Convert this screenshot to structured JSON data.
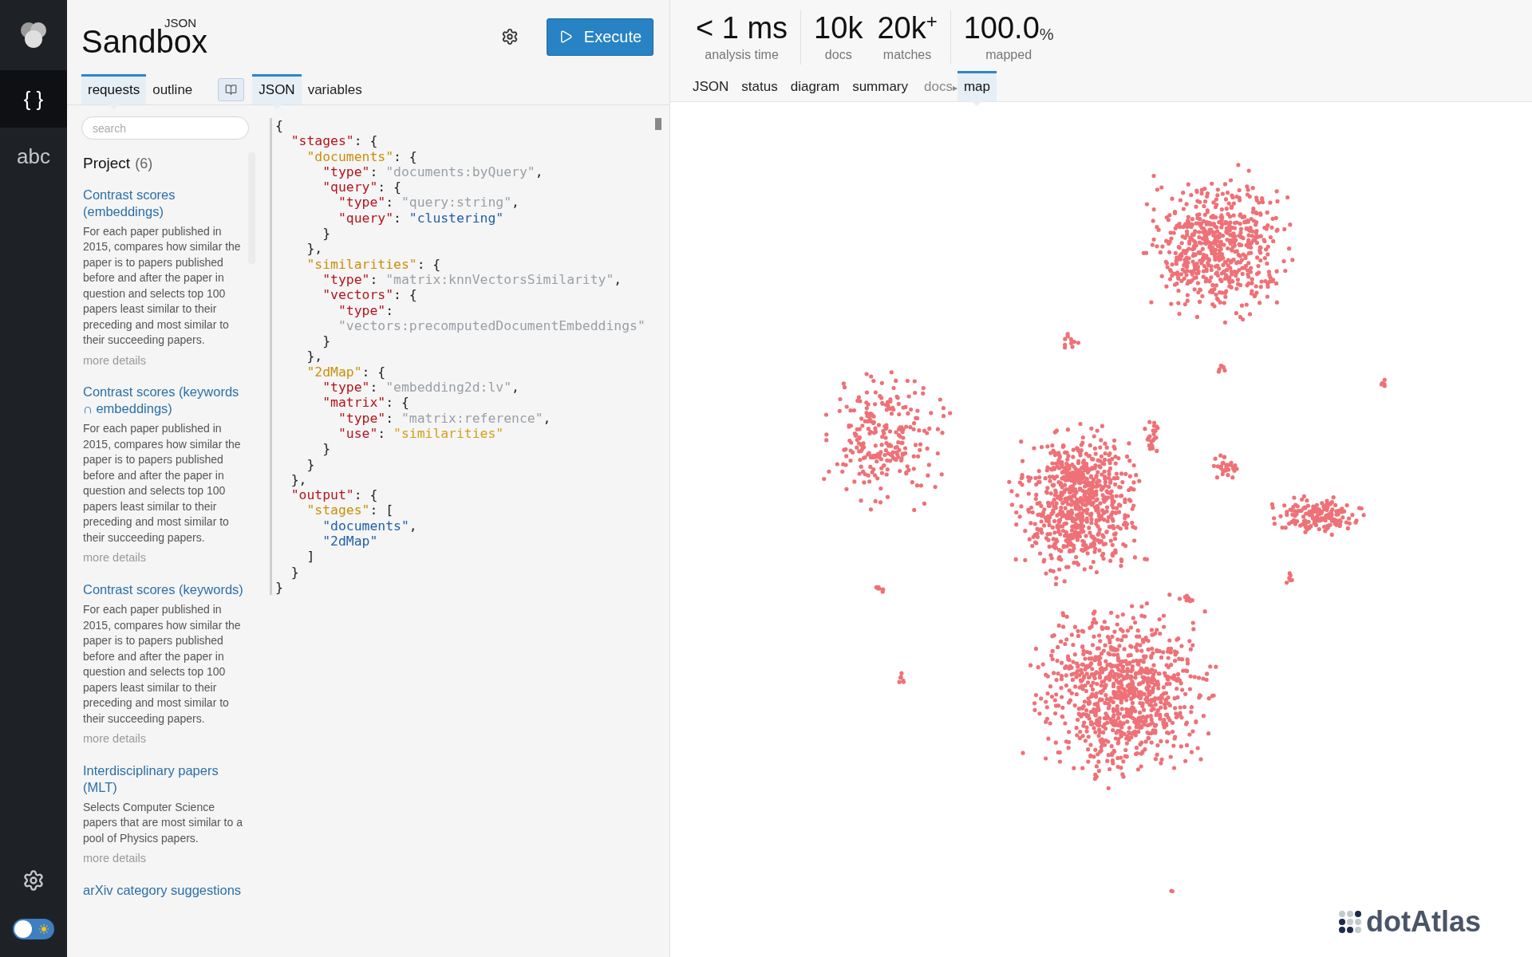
{
  "nav": {
    "items": [
      {
        "label": "{ }",
        "selected": true
      },
      {
        "label": "abc",
        "selected": false
      }
    ],
    "theme_toggle": {
      "on": false
    }
  },
  "app": {
    "title": "Sandbox",
    "super": "JSON"
  },
  "execute_button": {
    "label": "Execute"
  },
  "left_tabs": [
    {
      "label": "requests",
      "selected": true
    },
    {
      "label": "outline",
      "selected": false
    }
  ],
  "editor_tabs": [
    {
      "label": "JSON",
      "selected": true
    },
    {
      "label": "variables",
      "selected": false
    }
  ],
  "search": {
    "placeholder": "search"
  },
  "project": {
    "title": "Project",
    "count": "(6)",
    "items": [
      {
        "title": "Contrast scores (embeddings)",
        "description": "For each paper published in 2015, compares how similar the paper is to papers published before and after the paper in question and selects top 100 papers least similar to their preceding and most similar to their succeeding papers.",
        "link": "more details"
      },
      {
        "title": "Contrast scores (keywords ∩ embeddings)",
        "description": "For each paper published in 2015, compares how similar the paper is to papers published before and after the paper in question and selects top 100 papers least similar to their preceding and most similar to their succeeding papers.",
        "link": "more details"
      },
      {
        "title": "Contrast scores (keywords)",
        "description": "For each paper published in 2015, compares how similar the paper is to papers published before and after the paper in question and selects top 100 papers least similar to their preceding and most similar to their succeeding papers.",
        "link": "more details"
      },
      {
        "title": "Interdisciplinary papers (MLT)",
        "description": "Selects Computer Science papers that are most similar to a pool of Physics papers.",
        "link": "more details"
      },
      {
        "title": "arXiv category suggestions"
      }
    ]
  },
  "code": {
    "lines": [
      [
        {
          "kind": "p",
          "text": "{"
        }
      ],
      [
        {
          "kind": "key",
          "text": "  \"stages\""
        },
        {
          "kind": "p",
          "text": ": {"
        }
      ],
      [
        {
          "kind": "stage",
          "text": "    \"documents\""
        },
        {
          "kind": "p",
          "text": ": {"
        }
      ],
      [
        {
          "kind": "key",
          "text": "      \"type\""
        },
        {
          "kind": "p",
          "text": ": "
        },
        {
          "kind": "str",
          "text": "\"documents:byQuery\""
        },
        {
          "kind": "p",
          "text": ","
        }
      ],
      [
        {
          "kind": "key",
          "text": "      \"query\""
        },
        {
          "kind": "p",
          "text": ": {"
        }
      ],
      [
        {
          "kind": "key",
          "text": "        \"type\""
        },
        {
          "kind": "p",
          "text": ": "
        },
        {
          "kind": "str",
          "text": "\"query:string\""
        },
        {
          "kind": "p",
          "text": ","
        }
      ],
      [
        {
          "kind": "key",
          "text": "        \"query\""
        },
        {
          "kind": "p",
          "text": ": "
        },
        {
          "kind": "val",
          "text": "\"clustering\""
        }
      ],
      [
        {
          "kind": "p",
          "text": "      }"
        }
      ],
      [
        {
          "kind": "p",
          "text": "    },"
        }
      ],
      [
        {
          "kind": "stage",
          "text": "    \"similarities\""
        },
        {
          "kind": "p",
          "text": ": {"
        }
      ],
      [
        {
          "kind": "key",
          "text": "      \"type\""
        },
        {
          "kind": "p",
          "text": ": "
        },
        {
          "kind": "str",
          "text": "\"matrix:knnVectorsSimilarity\""
        },
        {
          "kind": "p",
          "text": ","
        }
      ],
      [
        {
          "kind": "key",
          "text": "      \"vectors\""
        },
        {
          "kind": "p",
          "text": ": {"
        }
      ],
      [
        {
          "kind": "key",
          "text": "        \"type\""
        },
        {
          "kind": "p",
          "text": ":"
        }
      ],
      [
        {
          "kind": "str",
          "text": "        \"vectors:precomputedDocumentEmbeddings\""
        }
      ],
      [
        {
          "kind": "p",
          "text": "      }"
        }
      ],
      [
        {
          "kind": "p",
          "text": "    },"
        }
      ],
      [
        {
          "kind": "stage",
          "text": "    \"2dMap\""
        },
        {
          "kind": "p",
          "text": ": {"
        }
      ],
      [
        {
          "kind": "key",
          "text": "      \"type\""
        },
        {
          "kind": "p",
          "text": ": "
        },
        {
          "kind": "str",
          "text": "\"embedding2d:lv\""
        },
        {
          "kind": "p",
          "text": ","
        }
      ],
      [
        {
          "kind": "key",
          "text": "      \"matrix\""
        },
        {
          "kind": "p",
          "text": ": {"
        }
      ],
      [
        {
          "kind": "key",
          "text": "        \"type\""
        },
        {
          "kind": "p",
          "text": ": "
        },
        {
          "kind": "str",
          "text": "\"matrix:reference\""
        },
        {
          "kind": "p",
          "text": ","
        }
      ],
      [
        {
          "kind": "key",
          "text": "        \"use\""
        },
        {
          "kind": "p",
          "text": ": "
        },
        {
          "kind": "ref",
          "text": "\"similarities\""
        }
      ],
      [
        {
          "kind": "p",
          "text": "      }"
        }
      ],
      [
        {
          "kind": "p",
          "text": "    }"
        }
      ],
      [
        {
          "kind": "p",
          "text": "  },"
        }
      ],
      [
        {
          "kind": "key",
          "text": "  \"output\""
        },
        {
          "kind": "p",
          "text": ": {"
        }
      ],
      [
        {
          "kind": "stage",
          "text": "    \"stages\""
        },
        {
          "kind": "p",
          "text": ": ["
        }
      ],
      [
        {
          "kind": "val",
          "text": "      \"documents\""
        },
        {
          "kind": "p",
          "text": ","
        }
      ],
      [
        {
          "kind": "val",
          "text": "      \"2dMap\""
        }
      ],
      [
        {
          "kind": "p",
          "text": "    ]"
        }
      ],
      [
        {
          "kind": "p",
          "text": "  }"
        }
      ],
      [
        {
          "kind": "p",
          "text": "}"
        }
      ]
    ]
  },
  "stats": [
    [
      {
        "value": "< 1 ms",
        "label": "analysis time"
      }
    ],
    [
      {
        "value": "10k",
        "label": "docs"
      },
      {
        "value": "20k",
        "unit": "+",
        "kind": "sup",
        "label": "matches"
      }
    ],
    [
      {
        "value": "100.0",
        "unit": "%",
        "kind": "sub",
        "label": "mapped"
      }
    ]
  ],
  "view_tabs": [
    {
      "label": "JSON",
      "selected": false
    },
    {
      "label": "status",
      "selected": false
    },
    {
      "label": "diagram",
      "selected": false
    },
    {
      "label": "summary",
      "selected": false
    }
  ],
  "breadcrumb": {
    "parent": "docs",
    "separator": "▸",
    "current": {
      "label": "map",
      "selected": true
    }
  },
  "brand": "dotAtlas"
}
